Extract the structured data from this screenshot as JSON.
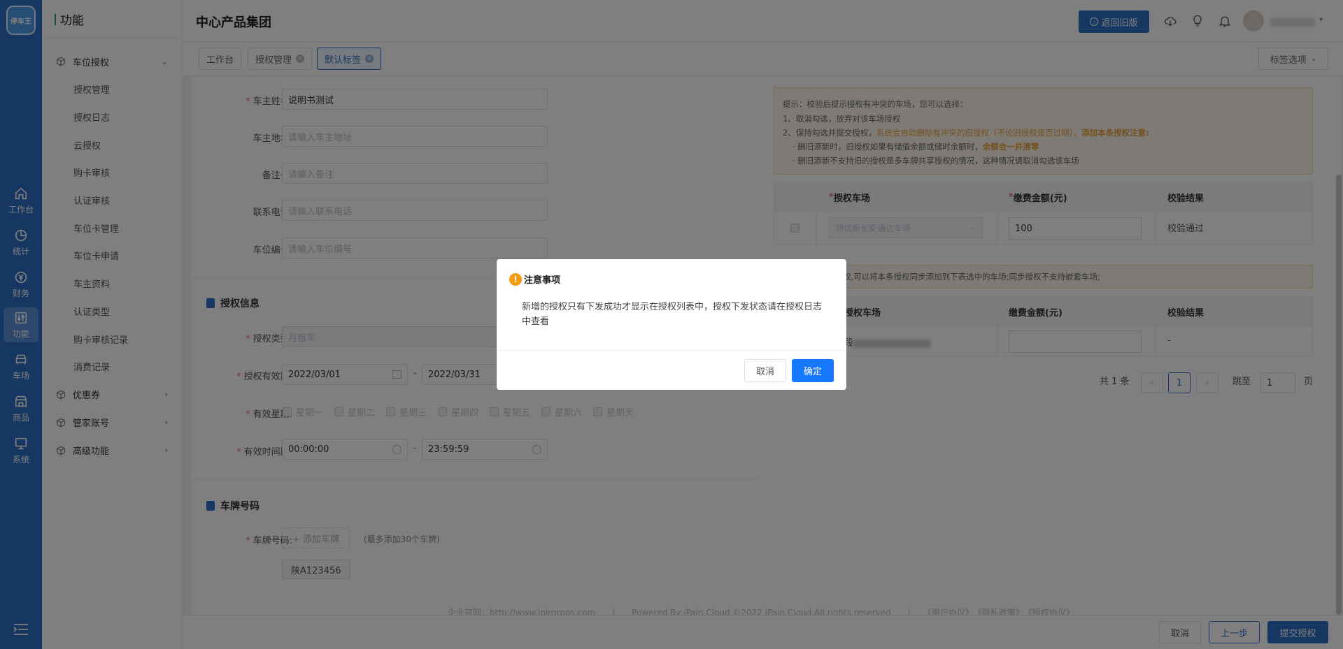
{
  "rail": {
    "logo_text": "停车王",
    "items": [
      {
        "label": "工作台",
        "icon": "home-icon"
      },
      {
        "label": "统计",
        "icon": "pie-chart-icon"
      },
      {
        "label": "财务",
        "icon": "yen-icon"
      },
      {
        "label": "功能",
        "icon": "sliders-icon"
      },
      {
        "label": "车场",
        "icon": "car-icon"
      },
      {
        "label": "商品",
        "icon": "shop-icon"
      },
      {
        "label": "系统",
        "icon": "monitor-icon"
      }
    ]
  },
  "menu": {
    "title": "功能",
    "group_auth": "车位授权",
    "sub_items": [
      "授权管理",
      "授权日志",
      "云授权",
      "购卡审核",
      "认证审核",
      "车位卡管理",
      "车位卡申请",
      "车主资料",
      "认证类型",
      "购卡审核记录",
      "消费记录"
    ],
    "group_coupon": "优惠券",
    "group_steward": "管家账号",
    "group_advanced": "高级功能"
  },
  "header": {
    "org_name": "中心产品集团",
    "back_label": "返回旧版"
  },
  "tabs": {
    "items": [
      "工作台",
      "授权管理",
      "默认标签"
    ],
    "tag_options": "标签选项"
  },
  "form": {
    "owner_name_label": "车主姓名:",
    "owner_name_value": "说明书测试",
    "owner_address_label": "车主地址:",
    "owner_address_placeholder": "请输入车主地址",
    "remark_label": "备注一:",
    "remark_placeholder": "请输入备注",
    "phone_label": "联系电话:",
    "phone_placeholder": "请输入联系电话",
    "slot_label": "车位编号:",
    "slot_placeholder": "请输入车位编号",
    "auth_section": "授权信息",
    "auth_type_label": "授权类型:",
    "auth_type_value": "月租车",
    "validity_label": "授权有效期:",
    "validity_start": "2022/03/01",
    "validity_end": "2022/03/31",
    "week_label": "有效星期:",
    "weekdays": [
      "星期一",
      "星期二",
      "星期三",
      "星期四",
      "星期五",
      "星期六",
      "星期天"
    ],
    "time_label": "有效时间段:",
    "time_start": "00:00:00",
    "time_end": "23:59:59",
    "plate_section": "车牌号码",
    "plate_label": "车牌号码:",
    "plate_add": "+ 添加车牌",
    "plate_hint": "(最多添加30个车牌)",
    "plate_value": "陕A123456"
  },
  "right": {
    "notice_line1": "提示：校验后提示授权有冲突的车场，您可以选择：",
    "notice_line2": "1、取消勾选，放弃对该车场授权",
    "notice_line3a": "2、保持勾选并提交授权，",
    "notice_line3b": "系统会自动删除有冲突的旧授权（不论旧授权是否过期），",
    "notice_line3c": "添加本条授权注意:",
    "notice_line4a": "· 删旧添新时，旧授权如果有储值余额或储时余额时，",
    "notice_line4b": "余额会一并清零",
    "notice_line5": "· 删旧添新不支持旧的授权是多车牌共享授权的情况，这种情况请取消勾选该车场",
    "table1_col1": "授权车场",
    "table1_col2": "缴费金额(元)",
    "table1_col3": "校验结果",
    "table1_row_lot": "测试新长安通达车场",
    "table1_row_amount": "100",
    "table1_row_result": "校验通过",
    "notice2": "权,可以将本条授权同步添加到下表选中的车场;同步授权不支持嵌套车场;",
    "table2_col1": "授权车场",
    "table2_col2": "缴费金额(元)",
    "table2_col3": "校验结果",
    "table2_row_lot": "段",
    "table2_row_result": "-",
    "pager_total": "共 1 条",
    "pager_page": "1",
    "pager_goto": "跳至",
    "pager_goto_value": "1",
    "pager_unit": "页"
  },
  "footer": {
    "text": "企业官网：http://www.ipirgrpos.com　　|　　Powered By iPain Cloud ©2022 iPain Cloud All rights reserved　　|　　《用户协议》　《隐私政策》　《授权协议》"
  },
  "actions": {
    "cancel": "取消",
    "prev": "上一步",
    "submit": "提交授权"
  },
  "dialog": {
    "title": "注意事项",
    "body": "新增的授权只有下发成功才显示在授权列表中，授权下发状态请在授权日志中查看",
    "cancel": "取消",
    "confirm": "确定"
  }
}
